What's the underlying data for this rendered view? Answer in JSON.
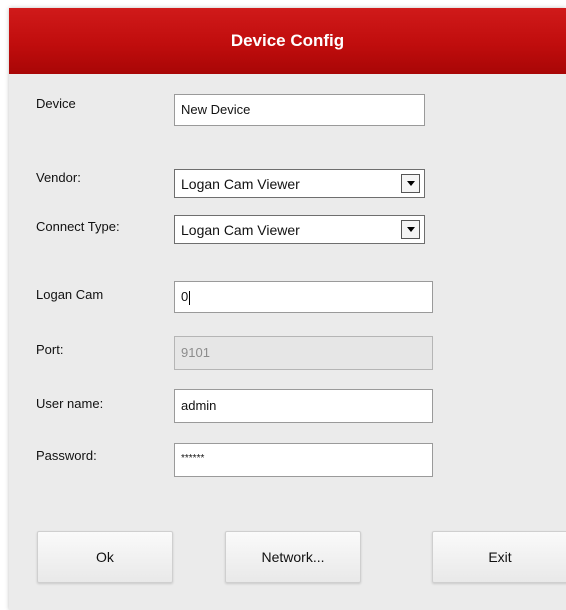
{
  "title": "Device Config",
  "form": {
    "device": {
      "label": "Device",
      "value": "New Device"
    },
    "vendor": {
      "label": "Vendor:",
      "value": "Logan Cam Viewer"
    },
    "connect_type": {
      "label": "Connect Type:",
      "value": "Logan Cam Viewer"
    },
    "logan_cam": {
      "label": "Logan Cam",
      "value": "0"
    },
    "port": {
      "label": "Port:",
      "value": "9101",
      "disabled": true
    },
    "user_name": {
      "label": "User name:",
      "value": "admin"
    },
    "password": {
      "label": "Password:",
      "value": "******"
    }
  },
  "buttons": {
    "ok": "Ok",
    "network": "Network...",
    "exit": "Exit"
  },
  "colors": {
    "title_bar": "#c00d0d",
    "dialog_bg": "#ebebeb"
  }
}
